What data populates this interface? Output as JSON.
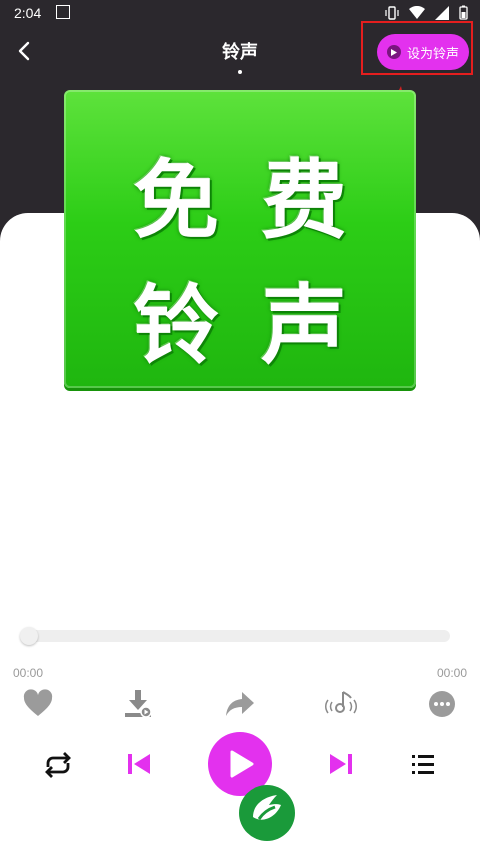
{
  "status_bar": {
    "time": "2:04"
  },
  "header": {
    "title": "铃声",
    "set_ringtone_label": "设为铃声"
  },
  "album_art": {
    "chars": [
      "免",
      "费",
      "铃",
      "声"
    ]
  },
  "player": {
    "time_current": "00:00",
    "time_total": "00:00",
    "progress": 0.0
  },
  "colors": {
    "accent": "#e331ee",
    "dark_bg": "#2b282d",
    "album_green": "#2ccd16",
    "highlight_red": "#e51e1e"
  },
  "icons": {
    "actions": [
      "heart-icon",
      "download-icon",
      "share-icon",
      "ringtone-wave-icon",
      "more-icon"
    ],
    "controls": [
      "repeat-icon",
      "previous-icon",
      "play-icon",
      "next-icon",
      "playlist-icon"
    ]
  }
}
